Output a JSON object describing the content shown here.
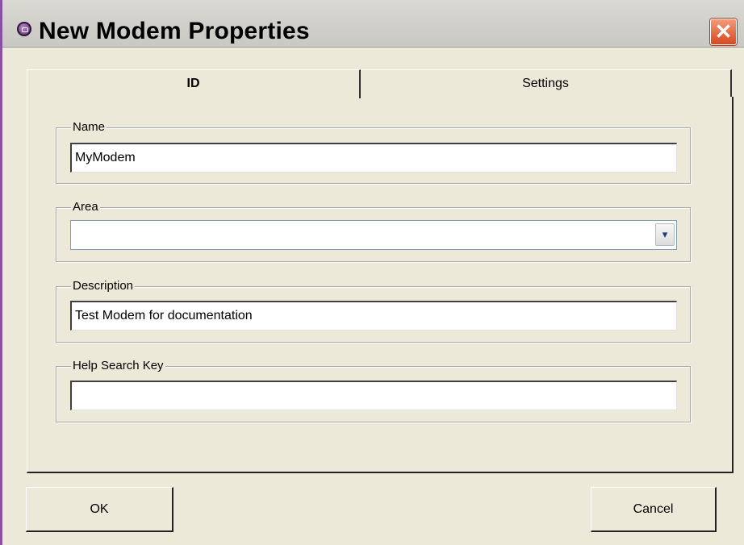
{
  "window": {
    "title": "New Modem Properties",
    "close_glyph": "✕"
  },
  "tabs": [
    {
      "label": "ID",
      "active": true
    },
    {
      "label": "Settings",
      "active": false
    }
  ],
  "form": {
    "name": {
      "label": "Name",
      "value": "MyModem"
    },
    "area": {
      "label": "Area",
      "value": "",
      "dropdown_glyph": "▾"
    },
    "description": {
      "label": "Description",
      "value": "Test Modem for documentation"
    },
    "help_search_key": {
      "label": "Help Search Key",
      "value": ""
    }
  },
  "buttons": {
    "ok": "OK",
    "cancel": "Cancel"
  },
  "colors": {
    "window_bg": "#ece9d8",
    "title_bar": "#d3d2cc",
    "close_button": "#d9481f",
    "accent_border": "#8a4fa0"
  },
  "icons": {
    "app": "app-icon",
    "close": "close-icon",
    "dropdown": "chevron-down-icon"
  }
}
